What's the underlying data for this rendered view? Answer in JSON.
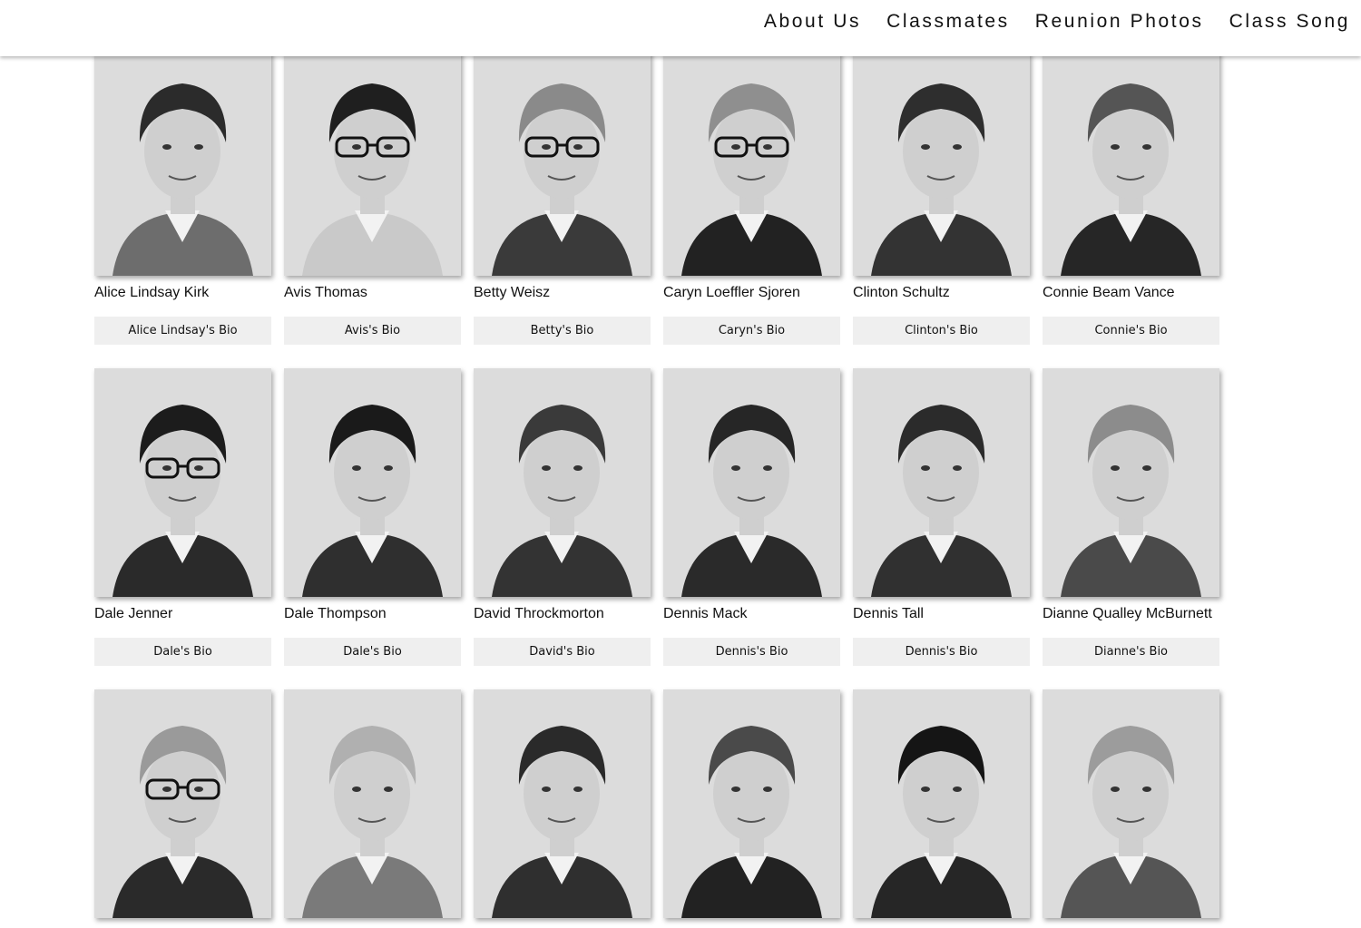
{
  "nav": {
    "items": [
      {
        "label": "About Us"
      },
      {
        "label": "Classmates"
      },
      {
        "label": "Reunion Photos"
      },
      {
        "label": "Class Song"
      }
    ]
  },
  "classmates": [
    {
      "name": "Alice Lindsay Kirk",
      "bio": "Alice Lindsay's Bio",
      "hair": "#2b2b2b",
      "glasses": false,
      "attire": "#6d6d6d"
    },
    {
      "name": "Avis Thomas",
      "bio": "Avis's Bio",
      "hair": "#1f1f1f",
      "glasses": true,
      "attire": "#c9c9c9"
    },
    {
      "name": "Betty Weisz",
      "bio": "Betty's Bio",
      "hair": "#8a8a8a",
      "glasses": true,
      "attire": "#3a3a3a"
    },
    {
      "name": "Caryn Loeffler Sjoren",
      "bio": "Caryn's Bio",
      "hair": "#8f8f8f",
      "glasses": true,
      "attire": "#222222"
    },
    {
      "name": "Clinton Schultz",
      "bio": "Clinton's Bio",
      "hair": "#2e2e2e",
      "glasses": false,
      "attire": "#333333"
    },
    {
      "name": "Connie Beam Vance",
      "bio": "Connie's Bio",
      "hair": "#555555",
      "glasses": false,
      "attire": "#262626"
    },
    {
      "name": "Dale Jenner",
      "bio": "Dale's Bio",
      "hair": "#1c1c1c",
      "glasses": true,
      "attire": "#2a2a2a"
    },
    {
      "name": "Dale Thompson",
      "bio": "Dale's Bio",
      "hair": "#1a1a1a",
      "glasses": false,
      "attire": "#2f2f2f"
    },
    {
      "name": "David Throckmorton",
      "bio": "David's Bio",
      "hair": "#3a3a3a",
      "glasses": false,
      "attire": "#333333"
    },
    {
      "name": "Dennis Mack",
      "bio": "Dennis's Bio",
      "hair": "#262626",
      "glasses": false,
      "attire": "#2a2a2a"
    },
    {
      "name": "Dennis Tall",
      "bio": "Dennis's Bio",
      "hair": "#2b2b2b",
      "glasses": false,
      "attire": "#303030"
    },
    {
      "name": "Dianne Qualley McBurnett",
      "bio": "Dianne's Bio",
      "hair": "#8c8c8c",
      "glasses": false,
      "attire": "#4a4a4a"
    },
    {
      "name": "",
      "bio": "",
      "hair": "#9a9a9a",
      "glasses": true,
      "attire": "#2a2a2a"
    },
    {
      "name": "",
      "bio": "",
      "hair": "#b0b0b0",
      "glasses": false,
      "attire": "#7a7a7a"
    },
    {
      "name": "",
      "bio": "",
      "hair": "#2a2a2a",
      "glasses": false,
      "attire": "#2f2f2f"
    },
    {
      "name": "",
      "bio": "",
      "hair": "#4a4a4a",
      "glasses": false,
      "attire": "#222222"
    },
    {
      "name": "",
      "bio": "",
      "hair": "#151515",
      "glasses": false,
      "attire": "#262626"
    },
    {
      "name": "",
      "bio": "",
      "hair": "#9c9c9c",
      "glasses": false,
      "attire": "#555555"
    }
  ]
}
